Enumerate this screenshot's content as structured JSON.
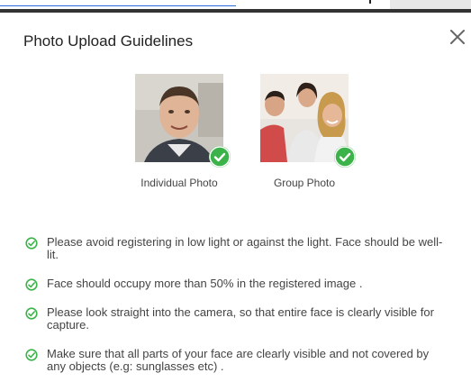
{
  "dialog": {
    "title": "Photo Upload Guidelines"
  },
  "photos": [
    {
      "label": "Individual Photo",
      "icon": "checkmark-badge-icon"
    },
    {
      "label": "Group Photo",
      "icon": "checkmark-badge-icon"
    }
  ],
  "guidelines": [
    "Please avoid registering in low light or against the light. Face should be well-lit.",
    "Face should occupy more than 50% in the registered image .",
    "Please look straight into the camera, so that entire face is clearly visible for capture.",
    "Make sure that all parts of your face are clearly visible and not covered by any objects (e.g: sunglasses etc) ."
  ],
  "colors": {
    "accent_green": "#3bb34a",
    "text": "#444444",
    "link_blue": "#2a6ad6"
  },
  "icons": {
    "close": "close-icon",
    "guideline_check": "check-circle-icon"
  }
}
